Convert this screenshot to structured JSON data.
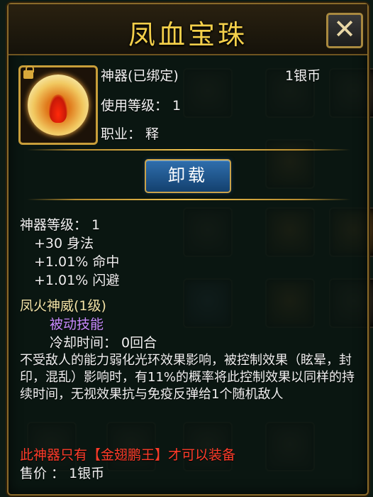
{
  "tooltip": {
    "title": "凤血宝珠",
    "close_label": "✕",
    "item_type": "神器(已绑定)",
    "price_top": "1银币",
    "use_level": "使用等级： 1",
    "profession": "职业： 释",
    "unload_label": "卸载",
    "artifact_level": "神器等级： 1",
    "stats": [
      "+30 身法",
      "+1.01% 命中",
      "+1.01% 闪避"
    ],
    "skill": {
      "name": "凤火神威(1级)",
      "type": "被动技能",
      "cooldown": "冷却时间： 0回合",
      "description": "不受敌人的能力弱化光环效果影响，被控制效果（眩晕，封印，混乱）影响时，有11%的概率将此控制效果以同样的持续时间，无视效果抗与免疫反弹给1个随机敌人"
    },
    "restriction": "此神器只有【金翅鹏王】才可以装备",
    "sell_price": "售价 ： 1银币"
  },
  "colors": {
    "title": "#f3cf4a",
    "skill_type": "#c98bff",
    "restriction": "#ff3c2a",
    "button": "#1f5a94"
  },
  "icons": [
    "lock-icon",
    "close-icon",
    "phoenix-orb-icon"
  ]
}
